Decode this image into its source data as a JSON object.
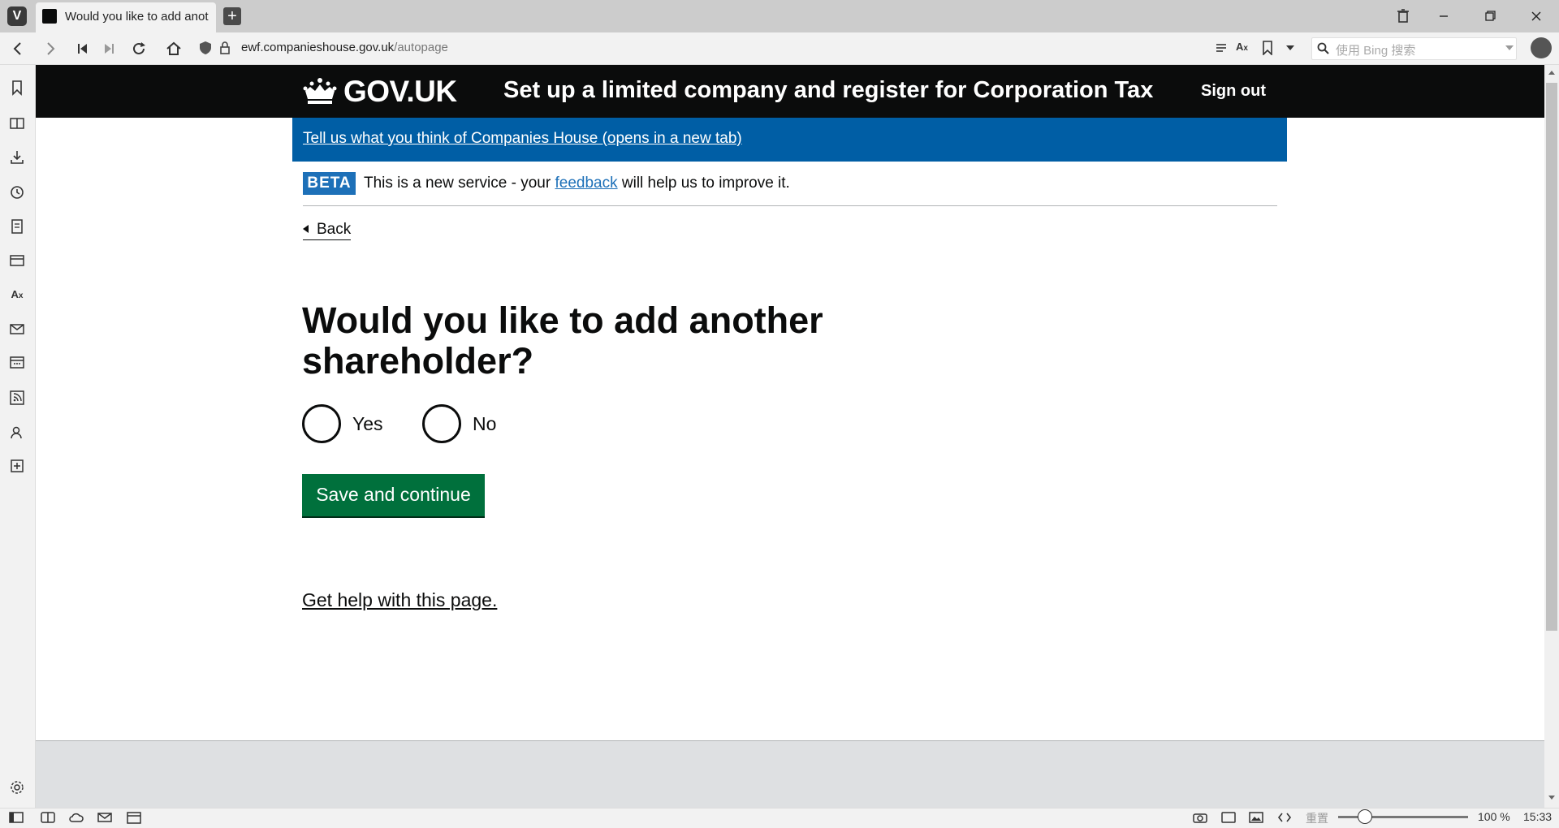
{
  "browser": {
    "tab_title": "Would you like to add anot",
    "url_host": "ewf.companieshouse.gov.uk",
    "url_path": "/autopage",
    "search_placeholder": "使用 Bing 搜索",
    "new_tab_symbol": "+"
  },
  "gov_header": {
    "logo_text": "GOV.UK",
    "service_name": "Set up a limited company and register for Corporation Tax",
    "sign_out": "Sign out"
  },
  "feedback_banner": {
    "link_text": "Tell us what you think of Companies House (opens in a new tab)"
  },
  "phase_banner": {
    "tag": "BETA",
    "text_before": "This is a new service - your ",
    "link_text": "feedback",
    "text_after": " will help us to improve it."
  },
  "back_link": "Back",
  "form": {
    "question": "Would you like to add another shareholder?",
    "options": [
      "Yes",
      "No"
    ],
    "submit_label": "Save and continue"
  },
  "help_link": "Get help with this page.",
  "statusbar": {
    "reset_label": "重置",
    "zoom": "100 %",
    "time": "15:33"
  },
  "colors": {
    "header_bg": "#0b0c0c",
    "feedback_banner_bg": "#005ea5",
    "beta_tag_bg": "#1d70b8",
    "button_green": "#00703c",
    "footer_bg": "#dee0e2"
  },
  "icons": {
    "sidebar": [
      "bookmarks-icon",
      "reading-list-icon",
      "downloads-icon",
      "history-icon",
      "notes-icon",
      "window-panel-icon",
      "translate-icon",
      "mail-icon",
      "calendar-icon",
      "feeds-icon",
      "contacts-icon",
      "add-panel-icon",
      "settings-icon"
    ]
  }
}
